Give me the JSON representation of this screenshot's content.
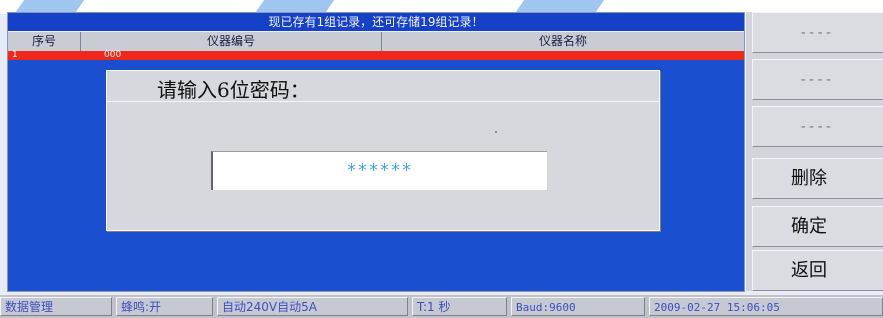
{
  "banner": "现已存有1组记录，还可存储19组记录！",
  "table": {
    "headers": [
      "序号",
      "仪器编号",
      "仪器名称"
    ],
    "rows": [
      {
        "index": "1",
        "code": "000",
        "name": ""
      }
    ]
  },
  "dialog": {
    "title": "请输入6位密码：",
    "password_mask": "******"
  },
  "side_buttons": [
    "----",
    "----",
    "----",
    "删除",
    "确定",
    "返回"
  ],
  "status": {
    "mode": "数据管理",
    "buzzer": "蜂鸣:开",
    "range": "自动240V自动5A",
    "interval": "T:1 秒",
    "baud": "Baud:9600",
    "datetime": "2009-02-27 15:06:05"
  },
  "colors": {
    "screen_bg": "#1a4fd0",
    "selected_row": "#f0281c",
    "mask_text": "#4aa6df"
  }
}
